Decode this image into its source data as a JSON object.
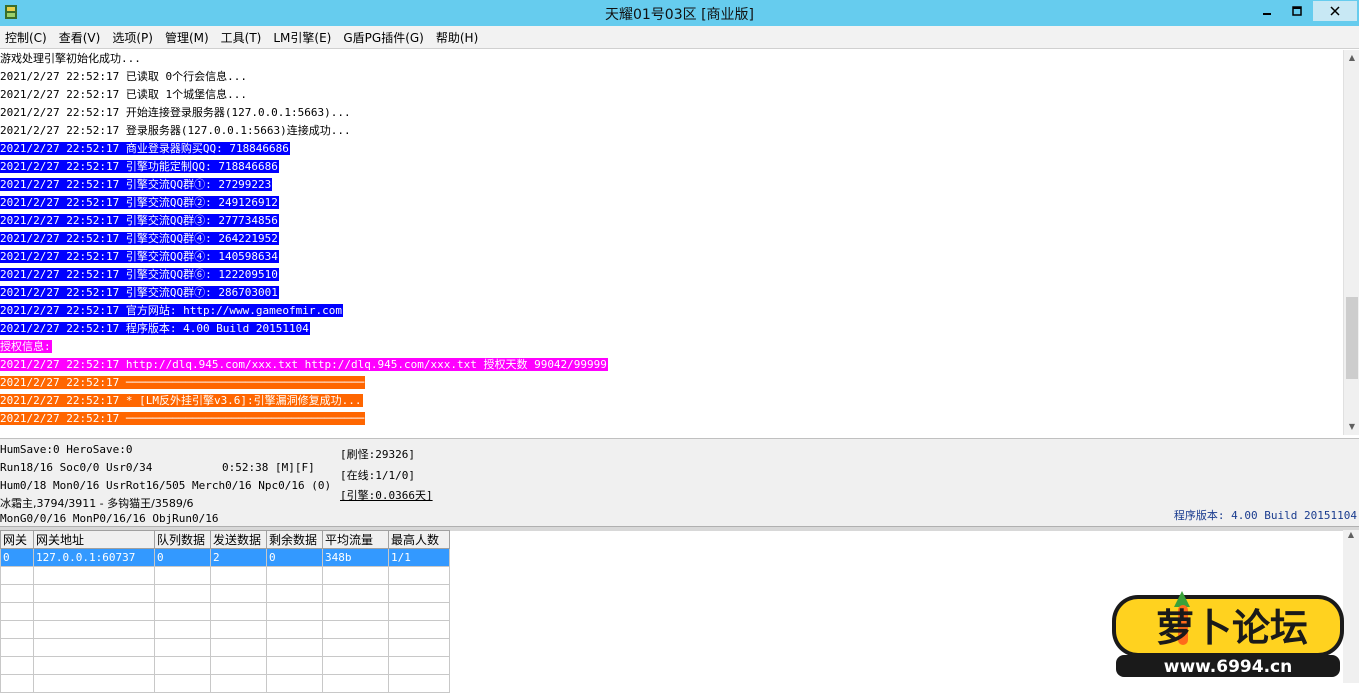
{
  "window": {
    "title": "天耀01号03区 [商业版]"
  },
  "icons": {
    "app": "app-icon",
    "minimize": "minimize-icon",
    "maximize": "maximize-icon",
    "close": "close-icon"
  },
  "menu": [
    "控制(C)",
    "查看(V)",
    "选项(P)",
    "管理(M)",
    "工具(T)",
    "LM引擎(E)",
    "G盾PG插件(G)",
    "帮助(H)"
  ],
  "log": [
    {
      "text": "游戏处理引擎初始化成功...",
      "hl": "none"
    },
    {
      "text": "2021/2/27 22:52:17 已读取 0个行会信息...",
      "hl": "none"
    },
    {
      "text": "2021/2/27 22:52:17 已读取 1个城堡信息...",
      "hl": "none"
    },
    {
      "text": "2021/2/27 22:52:17 开始连接登录服务器(127.0.0.1:5663)...",
      "hl": "none"
    },
    {
      "text": "2021/2/27 22:52:17 登录服务器(127.0.0.1:5663)连接成功...",
      "hl": "none"
    },
    {
      "text": "2021/2/27 22:52:17 商业登录器购买QQ: 718846686",
      "hl": "blue"
    },
    {
      "text": "2021/2/27 22:52:17 引擎功能定制QQ: 718846686",
      "hl": "blue"
    },
    {
      "text": "2021/2/27 22:52:17 引擎交流QQ群①: 27299223",
      "hl": "blue"
    },
    {
      "text": "2021/2/27 22:52:17 引擎交流QQ群②: 249126912",
      "hl": "blue"
    },
    {
      "text": "2021/2/27 22:52:17 引擎交流QQ群③: 277734856",
      "hl": "blue"
    },
    {
      "text": "2021/2/27 22:52:17 引擎交流QQ群④: 264221952",
      "hl": "blue"
    },
    {
      "text": "2021/2/27 22:52:17 引擎交流QQ群④: 140598634",
      "hl": "blue"
    },
    {
      "text": "2021/2/27 22:52:17 引擎交流QQ群⑥: 122209510",
      "hl": "blue"
    },
    {
      "text": "2021/2/27 22:52:17 引擎交流QQ群⑦: 286703001",
      "hl": "blue"
    },
    {
      "text": "2021/2/27 22:52:17 官方网站: http://www.gameofmir.com",
      "hl": "blue"
    },
    {
      "text": "2021/2/27 22:52:17 程序版本: 4.00 Build 20151104",
      "hl": "blue"
    },
    {
      "text": "授权信息:",
      "hl": "magenta"
    },
    {
      "text": "2021/2/27 22:52:17 http://dlq.945.com/xxx.txt http://dlq.945.com/xxx.txt 授权天数 99042/99999",
      "hl": "magenta"
    },
    {
      "text": "2021/2/27 22:52:17 ────────────────────────────────────",
      "hl": "orange"
    },
    {
      "text": "2021/2/27 22:52:17 * [LM反外挂引擎v3.6]:引擎漏洞修复成功...",
      "hl": "orange"
    },
    {
      "text": "2021/2/27 22:52:17 ────────────────────────────────────",
      "hl": "orange"
    }
  ],
  "status": {
    "line1": "HumSave:0 HeroSave:0",
    "line2": "Run18/16 Soc0/0 Usr0/34",
    "time": "0:52:38 [M][F]",
    "line3": "Hum0/18 Mon0/16 UsrRot16/505 Merch0/16 Npc0/16 (0)",
    "line4": "冰霜主,3794/3911 - 多钩猫王/3589/6",
    "line5": "MonG0/0/16 MonP0/16/16 ObjRun0/16",
    "refresh": "[刷怪:29326]",
    "online": "[在线:1/1/0]",
    "engine": "[引擎:0.0366天]",
    "version": "程序版本: 4.00 Build 20151104"
  },
  "grid": {
    "columns": [
      "网关",
      "网关地址",
      "队列数据",
      "发送数据",
      "剩余数据",
      "平均流量",
      "最高人数"
    ],
    "rows": [
      [
        "0",
        "127.0.0.1:60737",
        "0",
        "2",
        "0",
        "348b",
        "1/1"
      ]
    ]
  },
  "watermark": {
    "brand": "萝卜论坛",
    "url": "www.6994.cn"
  }
}
